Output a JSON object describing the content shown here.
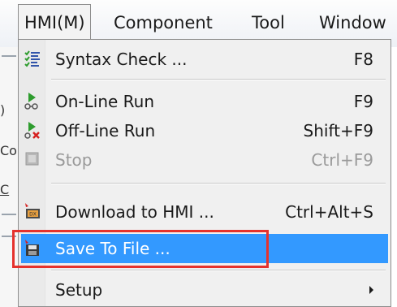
{
  "menubar": {
    "items": [
      {
        "label": "HMI(M)"
      },
      {
        "label": "Component"
      },
      {
        "label": "Tool"
      },
      {
        "label": "Window"
      }
    ]
  },
  "app_edge": {
    "fragments": [
      "Co",
      "C"
    ]
  },
  "dropdown": {
    "items": [
      {
        "label": "Syntax Check ...",
        "shortcut": "F8",
        "icon": "syntax-check-icon",
        "enabled": true
      },
      {
        "label": "On-Line Run",
        "shortcut": "F9",
        "icon": "online-run-icon",
        "enabled": true
      },
      {
        "label": "Off-Line Run",
        "shortcut": "Shift+F9",
        "icon": "offline-run-icon",
        "enabled": true
      },
      {
        "label": "Stop",
        "shortcut": "Ctrl+F9",
        "icon": "stop-icon",
        "enabled": false
      },
      {
        "label": "Download to HMI ...",
        "shortcut": "Ctrl+Alt+S",
        "icon": "download-icon",
        "enabled": true
      },
      {
        "label": "Save To File ...",
        "shortcut": "",
        "icon": "save-file-icon",
        "enabled": true,
        "highlighted": true
      },
      {
        "label": "Setup",
        "shortcut": "",
        "icon": "",
        "enabled": true,
        "has_submenu": true
      }
    ]
  },
  "colors": {
    "highlight": "#3399ff",
    "annotation": "#e5322d",
    "menu_background": "#f0f0f0",
    "disabled_text": "#9a9a9a"
  }
}
